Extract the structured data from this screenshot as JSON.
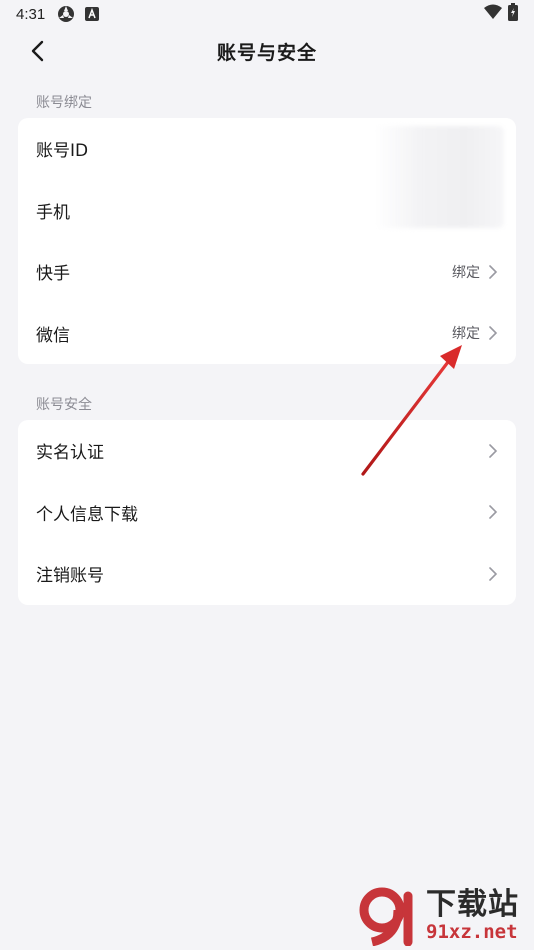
{
  "status_bar": {
    "time": "4:31"
  },
  "header": {
    "title": "账号与安全"
  },
  "account_binding": {
    "section_label": "账号绑定",
    "items": [
      {
        "label": "账号ID",
        "value": ""
      },
      {
        "label": "手机",
        "value": ""
      },
      {
        "label": "快手",
        "value": "绑定"
      },
      {
        "label": "微信",
        "value": "绑定"
      }
    ]
  },
  "account_security": {
    "section_label": "账号安全",
    "items": [
      {
        "label": "实名认证"
      },
      {
        "label": "个人信息下载"
      },
      {
        "label": "注销账号"
      }
    ]
  },
  "watermark": {
    "top": "下载站",
    "bottom": "91xz.net"
  },
  "colors": {
    "arrow": "#d92b2b",
    "background": "#f4f4f7",
    "card": "#ffffff",
    "watermark_red": "#c7353a"
  }
}
